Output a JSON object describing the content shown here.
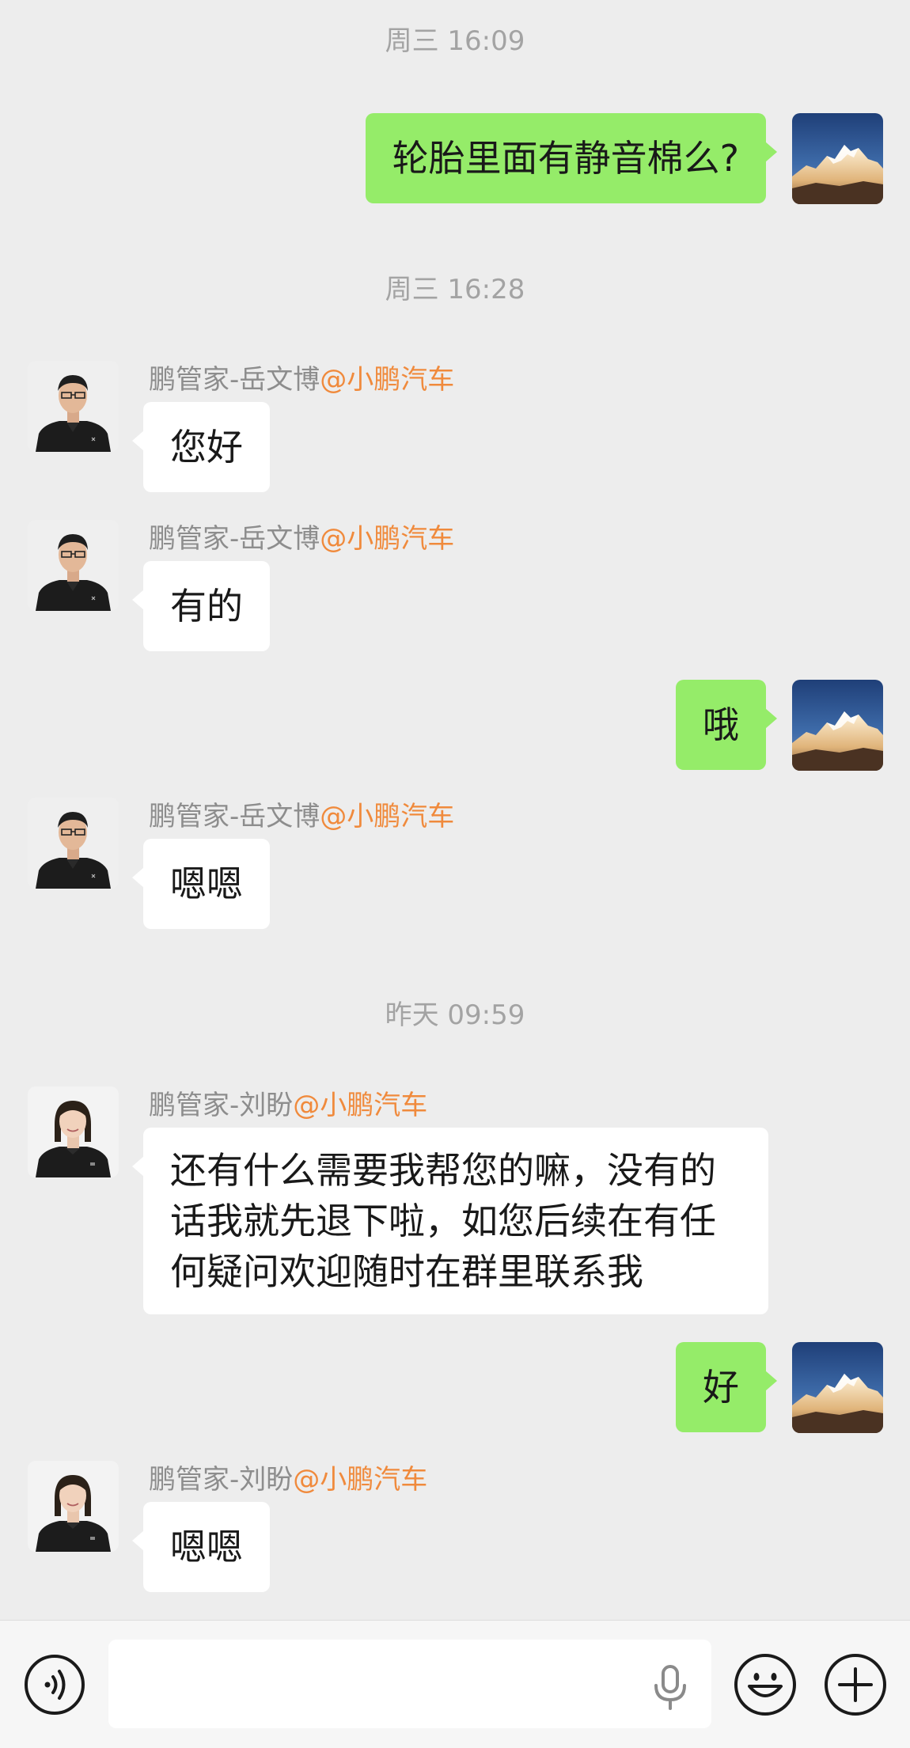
{
  "chat": {
    "timestamps": [
      "周三 16:09",
      "周三 16:28",
      "昨天 09:59"
    ],
    "messages": [
      {
        "direction": "out",
        "text": "轮胎里面有静音棉么?"
      },
      {
        "direction": "in",
        "sender": "鹏管家-岳文博",
        "org": "@小鹏汽车",
        "text": "您好"
      },
      {
        "direction": "in",
        "sender": "鹏管家-岳文博",
        "org": "@小鹏汽车",
        "text": "有的"
      },
      {
        "direction": "out",
        "text": "哦"
      },
      {
        "direction": "in",
        "sender": "鹏管家-岳文博",
        "org": "@小鹏汽车",
        "text": "嗯嗯"
      },
      {
        "direction": "in",
        "sender": "鹏管家-刘盼",
        "org": "@小鹏汽车",
        "text": "还有什么需要我帮您的嘛，没有的\n话我就先退下啦，如您后续在有任\n何疑问欢迎随时在群里联系我"
      },
      {
        "direction": "out",
        "text": "好"
      },
      {
        "direction": "in",
        "sender": "鹏管家-刘盼",
        "org": "@小鹏汽车",
        "text": "嗯嗯"
      }
    ]
  },
  "input_bar": {
    "voice_icon": "voice-icon",
    "mic_icon": "microphone-icon",
    "emoji_icon": "emoji-icon",
    "plus_icon": "plus-icon",
    "value": ""
  },
  "colors": {
    "background": "#ededed",
    "outgoing_bubble": "#95ec69",
    "incoming_bubble": "#ffffff",
    "org_accent": "#f08a3c",
    "timestamp": "#a3a3a3"
  }
}
